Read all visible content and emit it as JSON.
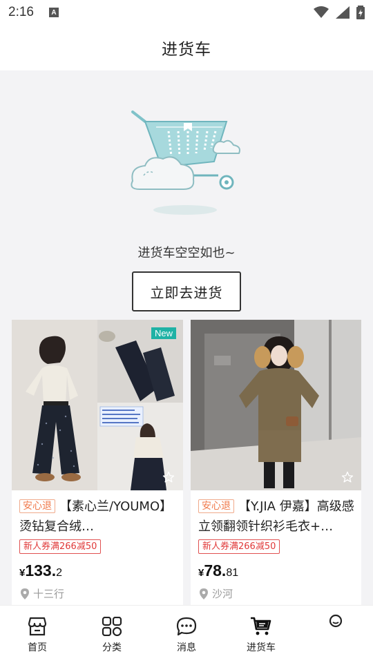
{
  "status_bar": {
    "time": "2:16"
  },
  "header": {
    "title": "进货车"
  },
  "empty_state": {
    "message": "进货车空空如也~",
    "button_label": "立即去进货"
  },
  "products": [
    {
      "tag": "安心退",
      "title": "【素心兰/YOUMO】烫钻复合绒…",
      "badge": "New",
      "coupon": "新人券满266减50",
      "price_currency": "¥",
      "price_int": "133.",
      "price_dec": "2",
      "location": "十三行",
      "photo_text": "YOUMO 7918 ..."
    },
    {
      "tag": "安心退",
      "title": "【Y.JIA 伊嘉】高级感立领翻领针织衫毛衣+…",
      "coupon": "新人券满266减50",
      "price_currency": "¥",
      "price_int": "78.",
      "price_dec": "81",
      "location": "沙河"
    }
  ],
  "tabbar": {
    "items": [
      {
        "label": "首页",
        "icon": "shop-icon"
      },
      {
        "label": "分类",
        "icon": "grid-icon"
      },
      {
        "label": "消息",
        "icon": "chat-icon"
      },
      {
        "label": "进货车",
        "icon": "cart-icon"
      },
      {
        "label": "",
        "icon": "profile-icon"
      }
    ]
  },
  "colors": {
    "accent_teal": "#1fb2a5",
    "coupon_red": "#e03838",
    "tag_orange": "#f07a4c"
  }
}
